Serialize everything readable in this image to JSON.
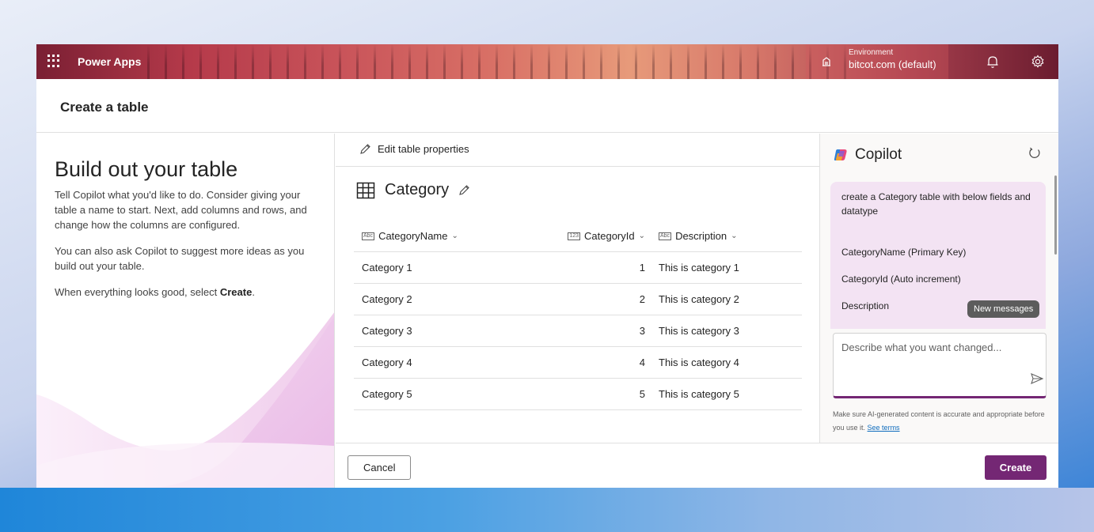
{
  "appbar": {
    "brand": "Power Apps",
    "environment_label": "Environment",
    "environment_value": "bitcot.com (default)"
  },
  "page": {
    "title": "Create a table"
  },
  "left": {
    "heading": "Build out your table",
    "p1": "Tell Copilot what you'd like to do. Consider giving your table a name to start. Next, add columns and rows, and change how the columns are configured.",
    "p2": "You can also ask Copilot to suggest more ideas as you build out your table.",
    "p3_prefix": "When everything looks good, select ",
    "p3_bold": "Create",
    "p3_suffix": "."
  },
  "center": {
    "edit_props": "Edit table properties",
    "table_name": "Category",
    "columns": [
      {
        "label": "CategoryName",
        "type_badge": "Abc"
      },
      {
        "label": "CategoryId",
        "type_badge": "123"
      },
      {
        "label": "Description",
        "type_badge": "Abc"
      }
    ],
    "rows": [
      [
        "Category 1",
        "1",
        "This is category 1"
      ],
      [
        "Category 2",
        "2",
        "This is category 2"
      ],
      [
        "Category 3",
        "3",
        "This is category 3"
      ],
      [
        "Category 4",
        "4",
        "This is category 4"
      ],
      [
        "Category 5",
        "5",
        "This is category 5"
      ]
    ]
  },
  "copilot": {
    "title": "Copilot",
    "message_lines": [
      "create a Category table with below fields and datatype",
      "CategoryName (Primary Key)",
      "CategoryId (Auto increment)",
      "Description"
    ],
    "new_messages": "New messages",
    "input_placeholder": "Describe what you want changed...",
    "disclaimer": "Make sure AI-generated content is accurate and appropriate before you use it.",
    "see_terms": "See terms"
  },
  "footer": {
    "cancel": "Cancel",
    "create": "Create"
  },
  "colors": {
    "accent": "#742774",
    "copilot_bubble": "#f3e3f3"
  }
}
